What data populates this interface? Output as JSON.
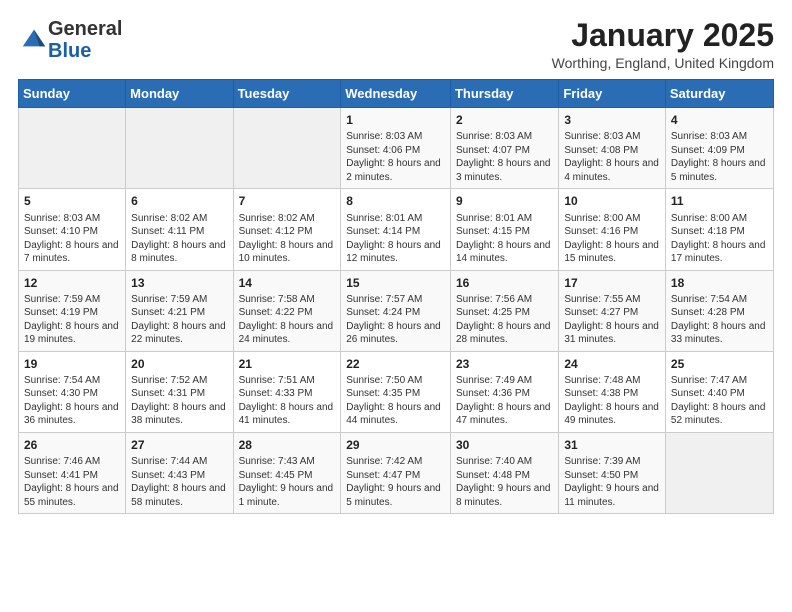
{
  "logo": {
    "general": "General",
    "blue": "Blue"
  },
  "header": {
    "month": "January 2025",
    "location": "Worthing, England, United Kingdom"
  },
  "weekdays": [
    "Sunday",
    "Monday",
    "Tuesday",
    "Wednesday",
    "Thursday",
    "Friday",
    "Saturday"
  ],
  "rows": [
    [
      {
        "day": "",
        "info": ""
      },
      {
        "day": "",
        "info": ""
      },
      {
        "day": "",
        "info": ""
      },
      {
        "day": "1",
        "info": "Sunrise: 8:03 AM\nSunset: 4:06 PM\nDaylight: 8 hours\nand 2 minutes."
      },
      {
        "day": "2",
        "info": "Sunrise: 8:03 AM\nSunset: 4:07 PM\nDaylight: 8 hours\nand 3 minutes."
      },
      {
        "day": "3",
        "info": "Sunrise: 8:03 AM\nSunset: 4:08 PM\nDaylight: 8 hours\nand 4 minutes."
      },
      {
        "day": "4",
        "info": "Sunrise: 8:03 AM\nSunset: 4:09 PM\nDaylight: 8 hours\nand 5 minutes."
      }
    ],
    [
      {
        "day": "5",
        "info": "Sunrise: 8:03 AM\nSunset: 4:10 PM\nDaylight: 8 hours\nand 7 minutes."
      },
      {
        "day": "6",
        "info": "Sunrise: 8:02 AM\nSunset: 4:11 PM\nDaylight: 8 hours\nand 8 minutes."
      },
      {
        "day": "7",
        "info": "Sunrise: 8:02 AM\nSunset: 4:12 PM\nDaylight: 8 hours\nand 10 minutes."
      },
      {
        "day": "8",
        "info": "Sunrise: 8:01 AM\nSunset: 4:14 PM\nDaylight: 8 hours\nand 12 minutes."
      },
      {
        "day": "9",
        "info": "Sunrise: 8:01 AM\nSunset: 4:15 PM\nDaylight: 8 hours\nand 14 minutes."
      },
      {
        "day": "10",
        "info": "Sunrise: 8:00 AM\nSunset: 4:16 PM\nDaylight: 8 hours\nand 15 minutes."
      },
      {
        "day": "11",
        "info": "Sunrise: 8:00 AM\nSunset: 4:18 PM\nDaylight: 8 hours\nand 17 minutes."
      }
    ],
    [
      {
        "day": "12",
        "info": "Sunrise: 7:59 AM\nSunset: 4:19 PM\nDaylight: 8 hours\nand 19 minutes."
      },
      {
        "day": "13",
        "info": "Sunrise: 7:59 AM\nSunset: 4:21 PM\nDaylight: 8 hours\nand 22 minutes."
      },
      {
        "day": "14",
        "info": "Sunrise: 7:58 AM\nSunset: 4:22 PM\nDaylight: 8 hours\nand 24 minutes."
      },
      {
        "day": "15",
        "info": "Sunrise: 7:57 AM\nSunset: 4:24 PM\nDaylight: 8 hours\nand 26 minutes."
      },
      {
        "day": "16",
        "info": "Sunrise: 7:56 AM\nSunset: 4:25 PM\nDaylight: 8 hours\nand 28 minutes."
      },
      {
        "day": "17",
        "info": "Sunrise: 7:55 AM\nSunset: 4:27 PM\nDaylight: 8 hours\nand 31 minutes."
      },
      {
        "day": "18",
        "info": "Sunrise: 7:54 AM\nSunset: 4:28 PM\nDaylight: 8 hours\nand 33 minutes."
      }
    ],
    [
      {
        "day": "19",
        "info": "Sunrise: 7:54 AM\nSunset: 4:30 PM\nDaylight: 8 hours\nand 36 minutes."
      },
      {
        "day": "20",
        "info": "Sunrise: 7:52 AM\nSunset: 4:31 PM\nDaylight: 8 hours\nand 38 minutes."
      },
      {
        "day": "21",
        "info": "Sunrise: 7:51 AM\nSunset: 4:33 PM\nDaylight: 8 hours\nand 41 minutes."
      },
      {
        "day": "22",
        "info": "Sunrise: 7:50 AM\nSunset: 4:35 PM\nDaylight: 8 hours\nand 44 minutes."
      },
      {
        "day": "23",
        "info": "Sunrise: 7:49 AM\nSunset: 4:36 PM\nDaylight: 8 hours\nand 47 minutes."
      },
      {
        "day": "24",
        "info": "Sunrise: 7:48 AM\nSunset: 4:38 PM\nDaylight: 8 hours\nand 49 minutes."
      },
      {
        "day": "25",
        "info": "Sunrise: 7:47 AM\nSunset: 4:40 PM\nDaylight: 8 hours\nand 52 minutes."
      }
    ],
    [
      {
        "day": "26",
        "info": "Sunrise: 7:46 AM\nSunset: 4:41 PM\nDaylight: 8 hours\nand 55 minutes."
      },
      {
        "day": "27",
        "info": "Sunrise: 7:44 AM\nSunset: 4:43 PM\nDaylight: 8 hours\nand 58 minutes."
      },
      {
        "day": "28",
        "info": "Sunrise: 7:43 AM\nSunset: 4:45 PM\nDaylight: 9 hours\nand 1 minute."
      },
      {
        "day": "29",
        "info": "Sunrise: 7:42 AM\nSunset: 4:47 PM\nDaylight: 9 hours\nand 5 minutes."
      },
      {
        "day": "30",
        "info": "Sunrise: 7:40 AM\nSunset: 4:48 PM\nDaylight: 9 hours\nand 8 minutes."
      },
      {
        "day": "31",
        "info": "Sunrise: 7:39 AM\nSunset: 4:50 PM\nDaylight: 9 hours\nand 11 minutes."
      },
      {
        "day": "",
        "info": ""
      }
    ]
  ]
}
